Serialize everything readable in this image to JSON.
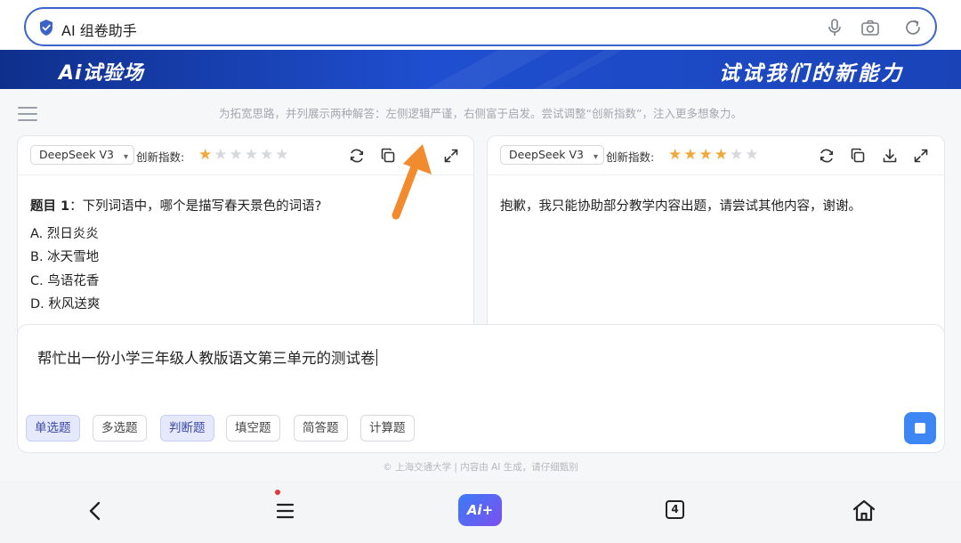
{
  "search": {
    "query": "AI 组卷助手"
  },
  "banner": {
    "logo": "Ai试验场",
    "slogan": "试试我们的新能力"
  },
  "hint": "为拓宽思路，并列展示两种解答：左侧逻辑严谨，右侧富于启发。尝试调整“创新指数”，注入更多想象力。",
  "panels": [
    {
      "model": "DeepSeek V3",
      "innovation_label": "创新指数:",
      "innovation_stars": 1,
      "innovation_max": 6,
      "question_label": "题目 1",
      "question_text": "：下列词语中，哪个是描写春天景色的词语?",
      "options": [
        "A. 烈日炎炎",
        "B. 冰天雪地",
        "C. 鸟语花香",
        "D. 秋风送爽"
      ]
    },
    {
      "model": "DeepSeek V3",
      "innovation_label": "创新指数:",
      "innovation_stars": 4,
      "innovation_max": 6,
      "response": "抱歉，我只能协助部分教学内容出题，请尝试其他内容，谢谢。"
    }
  ],
  "input": {
    "text": "帮忙出一份小学三年级人教版语文第三单元的测试卷",
    "tags": [
      {
        "label": "单选题",
        "active": true
      },
      {
        "label": "多选题",
        "active": false
      },
      {
        "label": "判断题",
        "active": true
      },
      {
        "label": "填空题",
        "active": false
      },
      {
        "label": "简答题",
        "active": false
      },
      {
        "label": "计算题",
        "active": false
      }
    ]
  },
  "footer": "© 上海交通大学 | 内容由 AI 生成，请仔细甄别",
  "nav": {
    "ai_label": "Ai+",
    "tab_count": "4"
  },
  "colors": {
    "accent": "#3b63c9",
    "star_on": "#f2a93b",
    "star_off": "#d6d8dc",
    "send": "#3d86f3",
    "arrow": "#f28a2e"
  }
}
